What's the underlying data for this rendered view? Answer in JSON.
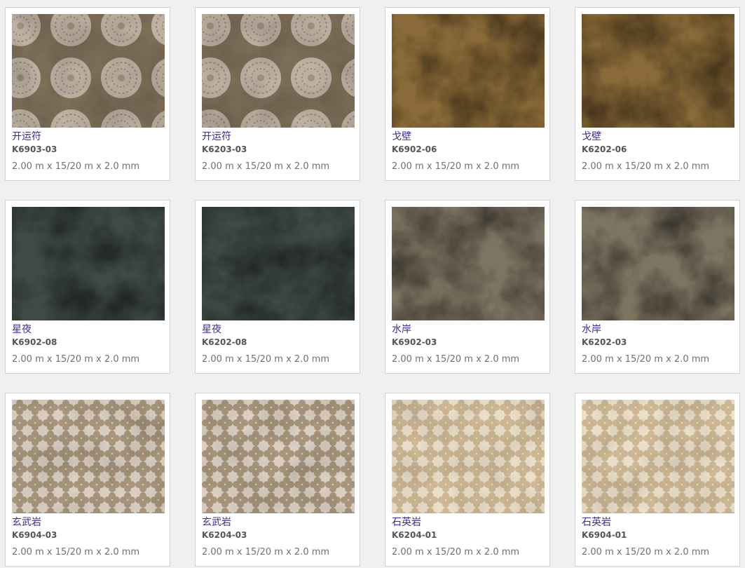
{
  "products": [
    {
      "name": "开运符",
      "code": "K6903-03",
      "dims": "2.00 m x 15/20 m x 2.0 mm",
      "pattern": "medallion",
      "base_color": "#7d6e58",
      "accent_color": "#c9bdb0"
    },
    {
      "name": "开运符",
      "code": "K6203-03",
      "dims": "2.00 m x 15/20 m x 2.0 mm",
      "pattern": "medallion",
      "base_color": "#7d6e58",
      "accent_color": "#c9bdb0"
    },
    {
      "name": "戈壁",
      "code": "K6902-06",
      "dims": "2.00 m x 15/20 m x 2.0 mm",
      "pattern": "mottled",
      "base_color": "#8a6a38",
      "accent_color": "#b08a48"
    },
    {
      "name": "戈壁",
      "code": "K6202-06",
      "dims": "2.00 m x 15/20 m x 2.0 mm",
      "pattern": "mottled",
      "base_color": "#8a6a38",
      "accent_color": "#b08a48"
    },
    {
      "name": "星夜",
      "code": "K6902-08",
      "dims": "2.00 m x 15/20 m x 2.0 mm",
      "pattern": "mottled",
      "base_color": "#3f4a44",
      "accent_color": "#5d6a62"
    },
    {
      "name": "星夜",
      "code": "K6202-08",
      "dims": "2.00 m x 15/20 m x 2.0 mm",
      "pattern": "mottled",
      "base_color": "#3f4a44",
      "accent_color": "#5d6a62"
    },
    {
      "name": "水岸",
      "code": "K6902-03",
      "dims": "2.00 m x 15/20 m x 2.0 mm",
      "pattern": "mottled",
      "base_color": "#7e7462",
      "accent_color": "#a39a86"
    },
    {
      "name": "水岸",
      "code": "K6202-03",
      "dims": "2.00 m x 15/20 m x 2.0 mm",
      "pattern": "mottled",
      "base_color": "#7e7462",
      "accent_color": "#a39a86"
    },
    {
      "name": "玄武岩",
      "code": "K6904-03",
      "dims": "2.00 m x 15/20 m x 2.0 mm",
      "pattern": "quatrefoil",
      "base_color": "#a8957c",
      "accent_color": "#d9cfc2"
    },
    {
      "name": "玄武岩",
      "code": "K6204-03",
      "dims": "2.00 m x 15/20 m x 2.0 mm",
      "pattern": "quatrefoil",
      "base_color": "#a8957c",
      "accent_color": "#d9cfc2"
    },
    {
      "name": "石英岩",
      "code": "K6204-01",
      "dims": "2.00 m x 15/20 m x 2.0 mm",
      "pattern": "quatrefoil",
      "base_color": "#cdb794",
      "accent_color": "#eadfca"
    },
    {
      "name": "石英岩",
      "code": "K6904-01",
      "dims": "2.00 m x 15/20 m x 2.0 mm",
      "pattern": "quatrefoil",
      "base_color": "#cdb794",
      "accent_color": "#eadfca"
    }
  ]
}
